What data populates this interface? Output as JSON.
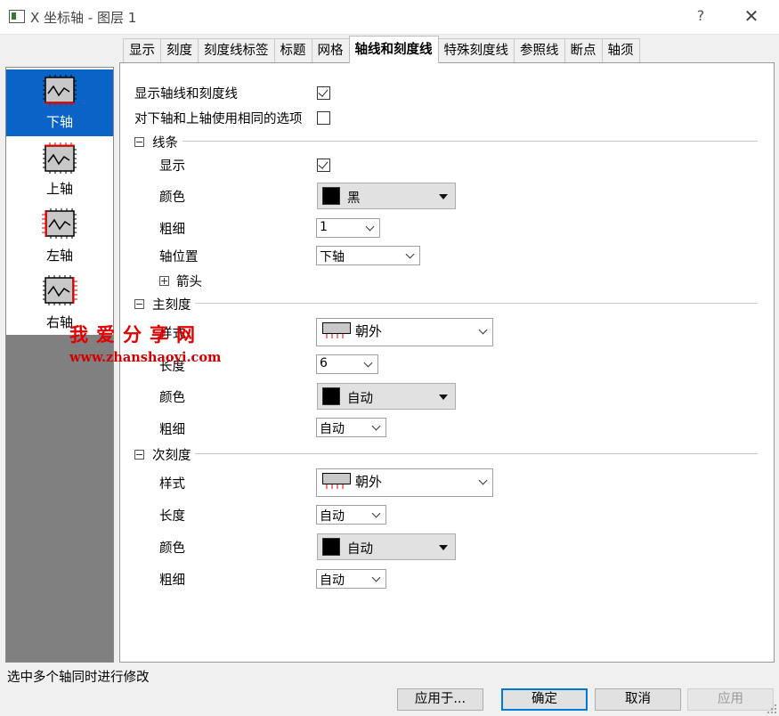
{
  "window": {
    "title": "X 坐标轴 - 图层 1",
    "help": "?",
    "close": "✕"
  },
  "tabs": [
    {
      "label": "显示"
    },
    {
      "label": "刻度"
    },
    {
      "label": "刻度线标签"
    },
    {
      "label": "标题"
    },
    {
      "label": "网格"
    },
    {
      "label": "轴线和刻度线",
      "active": true
    },
    {
      "label": "特殊刻度线"
    },
    {
      "label": "参照线"
    },
    {
      "label": "断点"
    },
    {
      "label": "轴须"
    }
  ],
  "axes": [
    {
      "label": "下轴",
      "selected": true,
      "icon": "bottom-axis-icon"
    },
    {
      "label": "上轴",
      "selected": false,
      "icon": "top-axis-icon"
    },
    {
      "label": "左轴",
      "selected": false,
      "icon": "left-axis-icon"
    },
    {
      "label": "右轴",
      "selected": false,
      "icon": "right-axis-icon"
    }
  ],
  "top_options": {
    "show_axis_label": "显示轴线和刻度线",
    "show_axis_checked": true,
    "same_options_label": "对下轴和上轴使用相同的选项",
    "same_options_checked": false
  },
  "line": {
    "section": "线条",
    "show_label": "显示",
    "show_checked": true,
    "color_label": "颜色",
    "color_value": "黑",
    "color_hex": "#000000",
    "thickness_label": "粗细",
    "thickness_value": "1",
    "position_label": "轴位置",
    "position_value": "下轴",
    "arrow_label": "箭头"
  },
  "major": {
    "section": "主刻度",
    "style_label": "样式",
    "style_value": "朝外",
    "length_label": "长度",
    "length_value": "6",
    "color_label": "颜色",
    "color_value": "自动",
    "color_hex": "#000000",
    "thickness_label": "粗细",
    "thickness_value": "自动"
  },
  "minor": {
    "section": "次刻度",
    "style_label": "样式",
    "style_value": "朝外",
    "length_label": "长度",
    "length_value": "自动",
    "color_label": "颜色",
    "color_value": "自动",
    "color_hex": "#000000",
    "thickness_label": "粗细",
    "thickness_value": "自动"
  },
  "watermark": {
    "title": "我爱分享网",
    "url": "www.zhanshaoyi.com"
  },
  "status": "选中多个轴同时进行修改",
  "buttons": {
    "apply_to": "应用于...",
    "ok": "确定",
    "cancel": "取消",
    "apply": "应用"
  },
  "colors": {
    "selection": "#0a64c8",
    "axis_red": "#e00000"
  }
}
